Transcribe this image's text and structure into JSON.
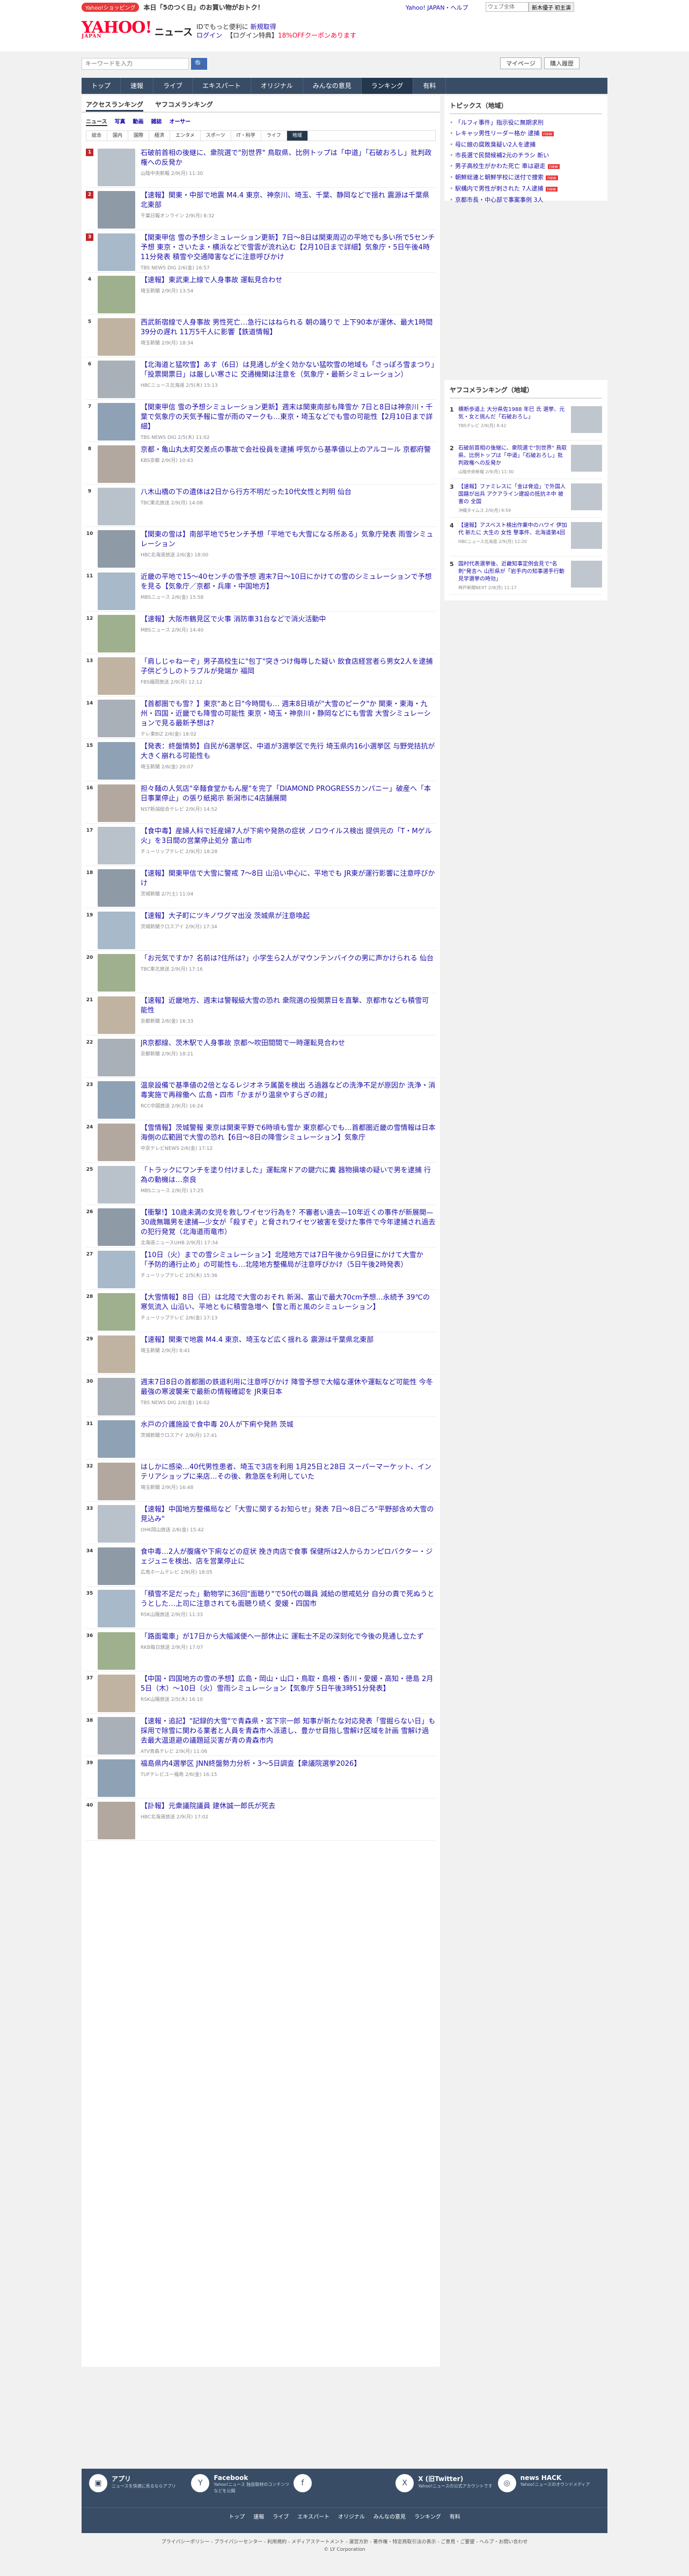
{
  "header": {
    "promo_tag": "Yahoo!ショッピング",
    "promo_text": "本日「5のつく日」のお買い物がおトク！",
    "links": "Yahoo! JAPAN・ヘルプ",
    "search_placeholder": "ウェブ全体",
    "search_button": "新木優子 初主演",
    "logo": "YAHOO!",
    "logo_sub": "JAPAN",
    "service": "ニュース",
    "msg1": "IDでもっと便利に",
    "msg1_link": "新規取得",
    "login": "ログイン",
    "msg2": "【ログイン特典】",
    "msg2_red": "18%OFFクーポンあります"
  },
  "searchbar": {
    "placeholder": "キーワードを入力",
    "mypage": "マイページ",
    "subscribe": "購入履歴"
  },
  "gnav": [
    "トップ",
    "速報",
    "ライブ",
    "エキスパート",
    "オリジナル",
    "みんなの意見",
    "ランキング",
    "有料"
  ],
  "gnav_current": 6,
  "tabs": {
    "access": "アクセスランキング",
    "comment": "ヤフコメランキング"
  },
  "content_tabs": [
    "ニュース",
    "写真",
    "動画",
    "雑誌",
    "オーサー"
  ],
  "categories": [
    "総合",
    "国内",
    "国際",
    "経済",
    "エンタメ",
    "スポーツ",
    "IT・科学",
    "ライフ",
    "地域"
  ],
  "category_current": 8,
  "ranking": [
    {
      "rank": "1",
      "title": "石破前首相の後継に、衆院選で\"別世界\" 鳥取県、比例トップは「中道」「石破おろし」批判政権への反発か",
      "meta": "山陰中央新報 2/9(月) 11:30"
    },
    {
      "rank": "2",
      "title": "【速報】関東・中部で地震 M4.4 東京、神奈川、埼玉、千葉、静岡などで揺れ 震源は千葉県北東部",
      "meta": "千葉日報オンライン 2/9(月) 8:32"
    },
    {
      "rank": "3",
      "title": "【関東甲信 雪の予想シミュレーション更新】7日〜8日は関東周辺の平地でも多い所で5センチ予想 東京・さいたま・横浜などで雪雲が流れ込む【2月10日まで詳細】気象庁・5日午後4時11分発表 積雪や交通障害などに注意呼びかけ",
      "meta": "TBS NEWS DIG 2/6(金) 16:57"
    },
    {
      "rank": "4",
      "title": "【速報】東武東上線で人身事故 運転見合わせ",
      "meta": "埼玉新聞 2/9(月) 13:54"
    },
    {
      "rank": "5",
      "title": "西武新宿線で人身事故 男性死亡…急行にはねられる 朝の踊りで 上下90本が運休、最大1時間39分の遅れ 11万5千人に影響【鉄道情報】",
      "meta": "埼玉新聞 2/9(月) 18:34"
    },
    {
      "rank": "6",
      "title": "【北海道と猛吹雪】あす（6日）は見通しが全く効かない猛吹雪の地域も「さっぽろ雪まつり」「投票開票日」は厳しい寒さに 交通機関は注意を（気象庁・最新シミュレーション）",
      "meta": "HBCニュース北海道 2/5(木) 15:13"
    },
    {
      "rank": "7",
      "title": "【関東甲信 雪の予想シミュレーション更新】週末は関東南部も降雪か 7日と8日は神奈川・千葉で気象庁の天気予報に雪が雨のマークも…東京・埼玉などでも雪の可能性【2月10日まで詳細】",
      "meta": "TBS NEWS DIG 2/5(木) 11:02"
    },
    {
      "rank": "8",
      "title": "京都・亀山丸太町交差点の事故で会社役員を逮捕 呼気から基準値以上のアルコール 京都府警",
      "meta": "KBS京都 2/9(月) 10:43"
    },
    {
      "rank": "9",
      "title": "八木山橋の下の遺体は2日から行方不明だった10代女性と判明 仙台",
      "meta": "TBC東北放送 2/9(月) 14:08"
    },
    {
      "rank": "10",
      "title": "【関東の雪は】南部平地で5センチ予想「平地でも大雪になる所ある」気象庁発表 雨雪シミュレーション",
      "meta": "HBC北海道放送 2/6(金) 18:00"
    },
    {
      "rank": "11",
      "title": "近畿の平地で15〜40センチの雪予想 週末7日〜10日にかけての雪のシミュレーションで予想を見る【気象庁／京都・兵庫・中国地方】",
      "meta": "MBSニュース 2/6(金) 15:58"
    },
    {
      "rank": "12",
      "title": "【速報】大阪市鶴見区で火事 消防車31台などで消火活動中",
      "meta": "MBSニュース 2/9(月) 14:40"
    },
    {
      "rank": "13",
      "title": "「肩しじゃねーぞ」男子高校生に\"包丁\"突きつけ侮辱した疑い 飲食店経営者ら男女2人を逮捕 子供どうしのトラブルが発端か 福岡",
      "meta": "FBS福岡放送 2/9(月) 12:12"
    },
    {
      "rank": "14",
      "title": "【首都圏でも雪？】東京\"あと日\"今時間も… 週末8日頃が\"大雪のピーク\"か 関東・東海・九州・四国・近畿でも降雪の可能性 東京・埼玉・神奈川・静岡などにも雪雲 大雪シミュレーションで見る最新予想は?",
      "meta": "テレ東BIZ 2/6(金) 18:02"
    },
    {
      "rank": "15",
      "title": "【発表：終盤情勢】自民が6選挙区、中道が3選挙区で先行 埼玉県内16小選挙区 与野党拮抗が大きく崩れる可能性も",
      "meta": "埼玉新聞 2/6(金) 20:07"
    },
    {
      "rank": "16",
      "title": "担々麺の人気店\"辛麺食堂かもん屋\"を完了「DIAMOND PROGRESSカンパニー」破産へ「本日事業停止」の張り紙掲示 新潟市に4店舗展開",
      "meta": "NST新潟総合テレビ 2/9(月) 14:52"
    },
    {
      "rank": "17",
      "title": "【食中毒】産婦人科で妊産婦7人が下痢や発熱の症状 ノロウイルス検出 提供元の「T・Mゲル火」を3日間の営業停止処分 富山市",
      "meta": "チューリップテレビ 2/9(月) 18:28"
    },
    {
      "rank": "18",
      "title": "【速報】関東甲信で大雪に警戒 7〜8日 山沿い中心に、平地でも JR東が運行影響に注意呼びかけ",
      "meta": "茨城新聞 2/7(土) 11:04"
    },
    {
      "rank": "19",
      "title": "【速報】大子町にツキノワグマ出没 茨城県が注意喚起",
      "meta": "茨城新聞クロスアイ 2/9(月) 17:34"
    },
    {
      "rank": "20",
      "title": "「お元気ですか？名前は?住所は?」小学生ら2人がマウンテンバイクの男に声かけられる 仙台",
      "meta": "TBC東北放送 2/9(月) 17:16"
    },
    {
      "rank": "21",
      "title": "【速報】近畿地方、週末は警報級大雪の恐れ 衆院選の投開票日を直撃、京都市なども積雪可能性",
      "meta": "京都新聞 2/6(金) 16:33"
    },
    {
      "rank": "22",
      "title": "JR京都線、茨木駅で人身事故 京都〜吹田間間で一時運転見合わせ",
      "meta": "京都新聞 2/9(月) 18:21"
    },
    {
      "rank": "23",
      "title": "温泉設備で基準値の2倍となるレジオネラ属菌を検出 ろ過器などの洗浄不足が原因か 洗浄・消毒実施で再稼働へ 広島・四市「かまがり温泉やすらぎの館」",
      "meta": "RCC中国放送 2/9(月) 16:24"
    },
    {
      "rank": "24",
      "title": "【雪情報】茨城警報 東京は関東平野で6時頃も雪か 東京都心でも…首都圏近畿の雪情報は日本海側の広範囲で大雪の恐れ【6日〜8日の降雪シミュレーション】気象庁",
      "meta": "中京テレビNEWS 2/6(金) 17:12"
    },
    {
      "rank": "25",
      "title": "「トラックにワンチを塗り付けました」運転席ドアの鍵穴に糞 器物損壊の疑いで男を逮捕 行為の動機は…奈良",
      "meta": "MBSニュース 2/9(月) 17:25"
    },
    {
      "rank": "26",
      "title": "【衝撃!】10歳未満の女児を救しワイセツ行為を？不審者い遠去—10年近くの事件が新展開—30歳無職男を逮捕—少女が「殺すぞ」と脅されワイセツ被害を受けた事件で今年逮捕され過去の犯行発覚（北海道雨竜市）",
      "meta": "北海道ニュースUHB 2/9(月) 17:34"
    },
    {
      "rank": "27",
      "title": "【10日（火）までの雪シミュレーション】北陸地方では7日午後から9日昼にかけて大雪か「予防的通行止め」の可能性も…北陸地方整備局が注意呼びかけ（5日午後2時発表）",
      "meta": "チューリップテレビ 2/5(木) 15:36"
    },
    {
      "rank": "28",
      "title": "【大雪情報】8日（日）は北陸で大雪のおそれ 新潟、富山で最大70cm予想…永続予 39℃の寒気流入 山沿い、平地ともに積雪急増へ【雪と雨と風のシミュレーション】",
      "meta": "チューリップテレビ 2/6(金) 17:13"
    },
    {
      "rank": "29",
      "title": "【速報】関東で地震 M4.4 東京、埼玉など広く揺れる 震源は千葉県北東部",
      "meta": "埼玉新聞 2/9(月) 8:41"
    },
    {
      "rank": "30",
      "title": "週末7日8日の首都圏の鉄道利用に注意呼びかけ 降雪予想で大幅な運休や運転など可能性 今冬最強の寒波襲来で最新の情報確認を JR東日本",
      "meta": "TBS NEWS DIG 2/6(金) 16:02"
    },
    {
      "rank": "31",
      "title": "水戸の介護施設で食中毒 20人が下痢や発熱 茨城",
      "meta": "茨城新聞クロスアイ 2/9(月) 17:41"
    },
    {
      "rank": "32",
      "title": "はしかに感染…40代男性患者、埼玉で3店を利用 1月25日と28日 スーパーマーケット、インテリアショップに来店…その後、救急医を利用していた",
      "meta": "埼玉新聞 2/9(月) 16:48"
    },
    {
      "rank": "33",
      "title": "【速報】中国地方整備局など「大雪に関するお知らせ」発表 7日〜8日ごろ\"平野部含め大雪の見込み\"",
      "meta": "OHK岡山放送 2/6(金) 15:42"
    },
    {
      "rank": "34",
      "title": "食中毒…2人が腹痛や下痢などの症状 挽き肉店で食事 保健所は2人からカンピロバクター・ジェジュニを検出、店を営業停止に",
      "meta": "広島ホームテレビ 2/9(月) 18:05"
    },
    {
      "rank": "35",
      "title": "「積雪不足だった」動物学に36回\"面聴り\"で50代の職員 減給の懲戒処分 自分の責で死ぬうとうとした…上司に注意されても面聴り続く 愛媛・四国市",
      "meta": "RSK山陽放送 2/9(月) 11:33"
    },
    {
      "rank": "36",
      "title": "「路面電車」が17日から大幅減便へ一部休止に 運転士不足の深刻化で今後の見通し立たず",
      "meta": "RKB毎日放送 2/9(月) 17:07"
    },
    {
      "rank": "37",
      "title": "【中国・四国地方の雪の予想】広島・岡山・山口・鳥取・島根・香川・愛媛・高知・徳島 2月5日（木）〜10日（火）雪雨シミュレーション【気象庁 5日午後3時51分発表】",
      "meta": "RSK山陽放送 2/5(木) 16:10"
    },
    {
      "rank": "38",
      "title": "【速報・追記】\"記録的大雪\"で青森県・宮下宗一郎 知事が新たな対応発表「雪掘らない日」も採用で除雪に関わる業者と人員を青森市へ派遣し、豊かせ目指し雪解け区域を計画 雪解け過去最大温退避の議題延災害が青の青森市内",
      "meta": "ATV青森テレビ 2/9(月) 11:06"
    },
    {
      "rank": "39",
      "title": "福島県内4選挙区 JNN終盤勢力分析・3〜5日調査【衆議院選挙2026】",
      "meta": "TUFテレビユー福島 2/6(金) 16:15"
    },
    {
      "rank": "40",
      "title": "【訃報】元衆議院議員 建休誠一郎氏が死去",
      "meta": "HBC北海道放送 2/9(月) 17:02"
    }
  ],
  "side": {
    "topics_head": "トピックス（地域）",
    "topics": [
      {
        "text": "「ルフィ事件」指示役に無期求刑",
        "badge": ""
      },
      {
        "text": "レキャッ男性リーダー格か 逮捕",
        "badge": "new"
      },
      {
        "text": "母に娘の腐敗臭疑い2人を逮捕",
        "badge": ""
      },
      {
        "text": "市長選で民間候補2元のチラシ 新い",
        "badge": ""
      },
      {
        "text": "男子高校生がかわた死亡 車は避走",
        "badge": "new"
      },
      {
        "text": "朝鮮総連と朝鮮学校に送付で捜索",
        "badge": "new"
      },
      {
        "text": "駅構内で男性が刺された 7人逮捕",
        "badge": "new"
      },
      {
        "text": "京都市長・中心部で事案事例 3人",
        "badge": ""
      }
    ],
    "comment_head": "ヤフコメランキング（地域）",
    "comment_rank": [
      {
        "rank": "1",
        "title": "横断歩道上 大分県佐1988 年巳 氏 選挙、元気・女と挑んだ「石破おろし」",
        "meta": "TBSテレビ 2/9(月) 8:42"
      },
      {
        "rank": "2",
        "title": "石破前首相の後継に、衆院選で\"別世界\" 鳥取県、比例トップは「中道」「石破おろし」批判政権への反発か",
        "meta": "山陰中央新報 2/9(月) 11:30"
      },
      {
        "rank": "3",
        "title": "【速報】ファミレスに「金は脅迫」で外国人国籍が出兵 アクアライン建設の抵抗ネ中 被害の 全国",
        "meta": "沖縄タイムス 2/9(月) 9:59"
      },
      {
        "rank": "4",
        "title": "【速報】アスベスト検出作業中のハワイ 伊加代 新たに 大生の 女性 撃事件、北海道第4回",
        "meta": "HBCニュース北海道 2/9(月) 12:20"
      },
      {
        "rank": "5",
        "title": "国村代表選挙後、近畿知事定例会見で\"名刺\"発言へ 山形県が「岩手内の知事選手行動 見学選挙の時効」",
        "meta": "神戸新聞NEXT 2/9(月) 11:17"
      }
    ]
  },
  "footer": {
    "cols": [
      {
        "icon": "▣",
        "head": "アプリ",
        "desc": "ニュースを快適に見るならアプリ"
      },
      {
        "icon": "Y",
        "head": "Facebook",
        "desc": "Yahoo!ニュース 独自取材のコンテンツなどを公開"
      },
      {
        "icon": "f",
        "head": "",
        "desc": ""
      },
      {
        "icon": "X",
        "head": "X (旧Twitter)",
        "desc": "Yahoo!ニュースの公式アカウントです"
      },
      {
        "icon": "◎",
        "head": "news HACK",
        "desc": "Yahoo!ニュースのオウンドメディア"
      }
    ],
    "nav": [
      "トップ",
      "速報",
      "ライブ",
      "エキスパート",
      "オリジナル",
      "みんなの意見",
      "ランキング",
      "有料"
    ],
    "legal": "プライバシーポリシー - プライバシーセンター - 利用規約 - メディアステートメント - 運営方針 - 著作権・特定商取引法の表示 - ご意見・ご要望 - ヘルプ・お問い合わせ",
    "copyright": "© LY Corporation"
  }
}
